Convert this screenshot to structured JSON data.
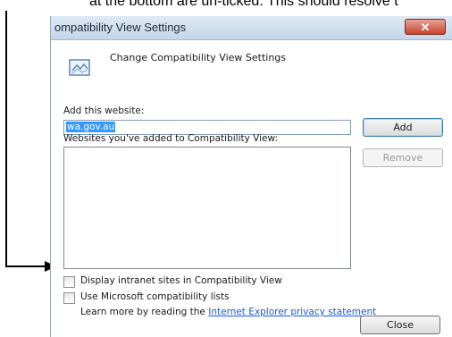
{
  "annotation": {
    "caption": "at the bottom are un-ticked. This should resolve t"
  },
  "dialog": {
    "title": "ompatibility View Settings",
    "close_glyph": "✕",
    "header_title": "Change Compatibility View Settings",
    "add_label": "Add this website:",
    "site_input_value": "wa.gov.au",
    "add_button": "Add",
    "list_label": "Websites you've added to Compatibility View:",
    "remove_button": "Remove",
    "websites": [],
    "checkboxes": [
      {
        "label": "Display intranet sites in Compatibility View",
        "checked": false
      },
      {
        "label": "Use Microsoft compatibility lists",
        "checked": false
      }
    ],
    "learn_more_prefix": "Learn more by reading the ",
    "learn_more_link": "Internet Explorer privacy statement",
    "close_button": "Close"
  },
  "icons": {
    "header": "compatibility-view-icon",
    "close": "close-icon"
  },
  "colors": {
    "title_bar": "#c5d6ea",
    "selection": "#3399ff",
    "link": "#1a5bd6",
    "close_button": "#c7432d"
  }
}
